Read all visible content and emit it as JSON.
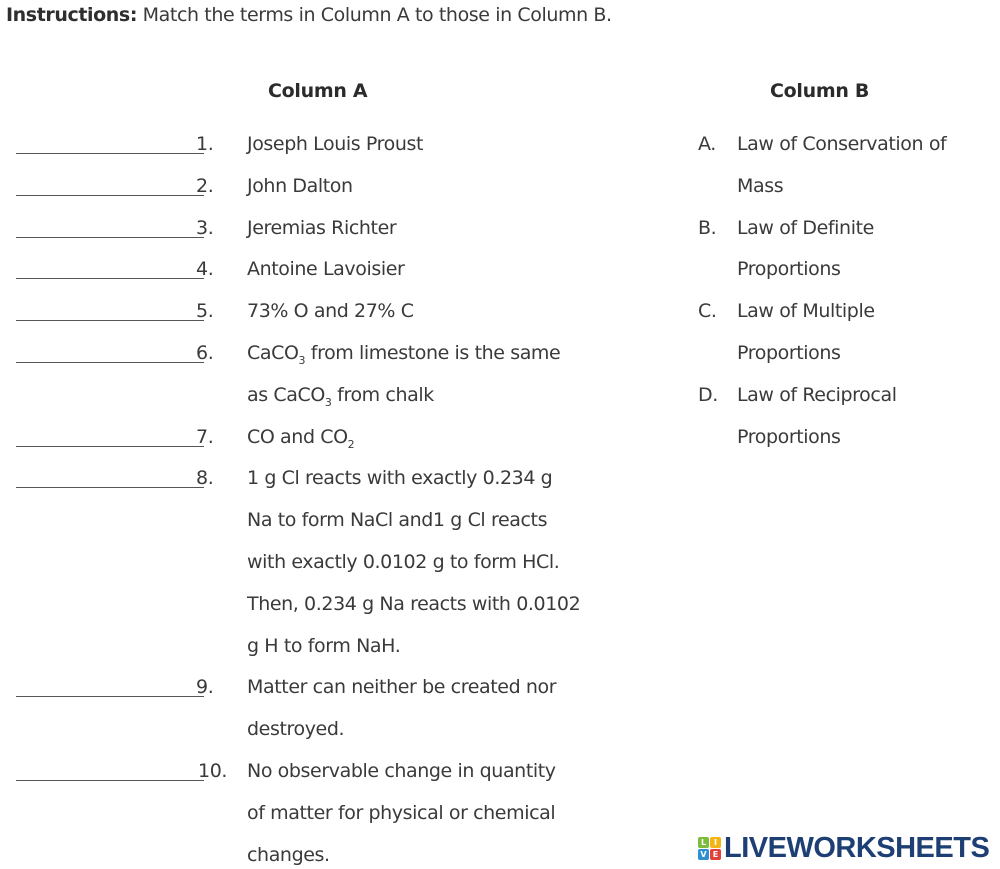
{
  "instructions": {
    "label": "Instructions:",
    "text": " Match the terms in Column A to those in Column B."
  },
  "column_a": {
    "heading": "Column A",
    "items": [
      {
        "number": "1.",
        "lines": [
          "Joseph Louis Proust"
        ]
      },
      {
        "number": "2.",
        "lines": [
          "John Dalton"
        ]
      },
      {
        "number": "3.",
        "lines": [
          "Jeremias Richter"
        ]
      },
      {
        "number": "4.",
        "lines": [
          "Antoine Lavoisier"
        ]
      },
      {
        "number": "5.",
        "lines": [
          "73% O and 27% C"
        ]
      },
      {
        "number": "6.",
        "lines": [
          "CaCO{3} from limestone is the same",
          "as CaCO{3} from chalk"
        ]
      },
      {
        "number": "7.",
        "lines": [
          "CO and CO{2}"
        ]
      },
      {
        "number": "8.",
        "lines": [
          "1 g Cl reacts with exactly 0.234 g",
          "Na to form NaCl and1 g Cl reacts",
          "with exactly 0.0102 g  to form HCl.",
          "Then, 0.234 g Na reacts with 0.0102",
          "g  H to form NaH."
        ]
      },
      {
        "number": "9.",
        "lines": [
          "Matter can neither be created nor",
          "destroyed."
        ]
      },
      {
        "number": "10.",
        "lines": [
          "No observable change in quantity",
          "of matter for physical or chemical",
          "changes."
        ]
      }
    ]
  },
  "column_b": {
    "heading": "Column B",
    "items": [
      {
        "letter": "A.",
        "lines": [
          "Law of Conservation of",
          "Mass"
        ]
      },
      {
        "letter": "B.",
        "lines": [
          "Law of Definite",
          "Proportions"
        ]
      },
      {
        "letter": "C.",
        "lines": [
          "Law of Multiple",
          "Proportions"
        ]
      },
      {
        "letter": "D.",
        "lines": [
          "Law of Reciprocal",
          "Proportions"
        ]
      }
    ]
  },
  "logo": {
    "text": "LIVEWORKSHEETS",
    "blocks": [
      {
        "letter": "L",
        "color": "#7dbb3c"
      },
      {
        "letter": "I",
        "color": "#f2b417"
      },
      {
        "letter": "V",
        "color": "#2f8fd0"
      },
      {
        "letter": "E",
        "color": "#e2403a"
      }
    ],
    "text_color": "#1d3f73"
  }
}
